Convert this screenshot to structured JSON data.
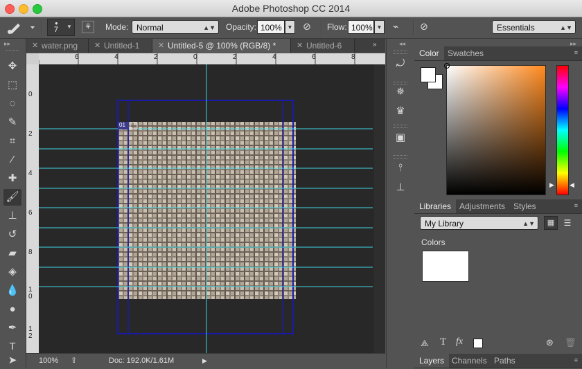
{
  "window": {
    "title": "Adobe Photoshop CC 2014"
  },
  "options_bar": {
    "brush_size": "7",
    "mode_label": "Mode:",
    "mode_value": "Normal",
    "opacity_label": "Opacity:",
    "opacity_value": "100%",
    "flow_label": "Flow:",
    "flow_value": "100%",
    "workspace": "Essentials"
  },
  "tabs": [
    {
      "label": "water.png",
      "active": false
    },
    {
      "label": "Untitled-1",
      "active": false
    },
    {
      "label": "Untitled-5 @ 100% (RGB/8) *",
      "active": true
    },
    {
      "label": "Untitled-6",
      "active": false
    }
  ],
  "rulers": {
    "top_ticks": [
      "6",
      "4",
      "2",
      "0",
      "2",
      "4",
      "6",
      "8"
    ],
    "left_ticks": [
      "0",
      "2",
      "4",
      "6",
      "8",
      "1\n0",
      "1\n2"
    ]
  },
  "canvas": {
    "slice_badge": "01"
  },
  "status_bar": {
    "zoom": "100%",
    "doc_info": "Doc: 192.0K/1.61M"
  },
  "color_panel": {
    "tabs": [
      "Color",
      "Swatches"
    ],
    "foreground": "#ffffff",
    "background": "#ffffff",
    "hue_color": "#ff8a1e"
  },
  "libraries_panel": {
    "tabs": [
      "Libraries",
      "Adjustments",
      "Styles"
    ],
    "library_select": "My Library",
    "section_label": "Colors",
    "swatch_color": "#ffffff"
  },
  "layers_panel": {
    "tabs": [
      "Layers",
      "Channels",
      "Paths"
    ]
  },
  "icons": {
    "toolbox": [
      "move-icon",
      "marquee-icon",
      "lasso-icon",
      "quick-selection-icon",
      "crop-icon",
      "eyedropper-icon",
      "healing-brush-icon",
      "brush-icon",
      "clone-stamp-icon",
      "history-brush-icon",
      "eraser-icon",
      "paint-bucket-icon",
      "blur-icon",
      "dodge-icon",
      "pen-icon",
      "type-icon",
      "path-selection-icon"
    ],
    "strip": [
      "history-icon",
      "navigator-icon",
      "histogram-icon",
      "properties-icon",
      "brush-presets-icon",
      "clone-source-icon"
    ]
  }
}
